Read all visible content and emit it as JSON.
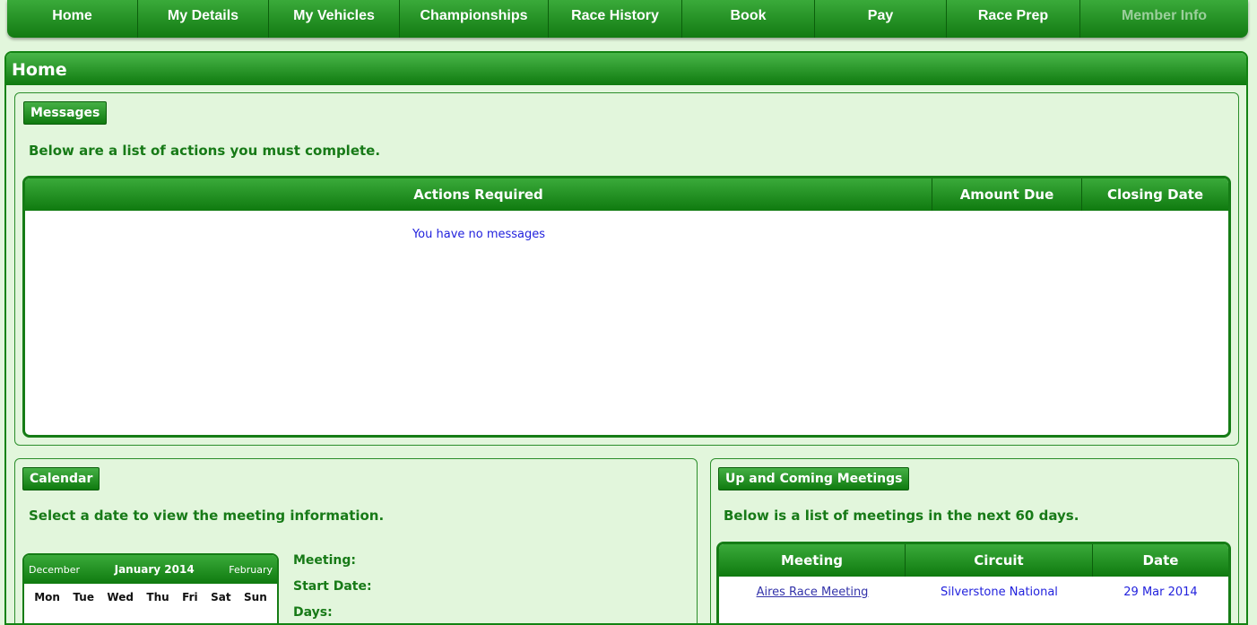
{
  "nav": {
    "items": [
      "Home",
      "My Details",
      "My Vehicles",
      "Championships",
      "Race History",
      "Book",
      "Pay",
      "Race Prep",
      "Member Info"
    ]
  },
  "page": {
    "title": "Home"
  },
  "messages": {
    "tag": "Messages",
    "description": "Below are a list of actions you must complete.",
    "columns": [
      "Actions Required",
      "Amount Due",
      "Closing Date"
    ],
    "empty_text": "You have no messages"
  },
  "calendar": {
    "tag": "Calendar",
    "description": "Select a date to view the meeting information.",
    "prev": "December",
    "month": "January 2014",
    "next": "February",
    "days": [
      "Mon",
      "Tue",
      "Wed",
      "Thu",
      "Fri",
      "Sat",
      "Sun"
    ],
    "labels": [
      "Meeting:",
      "Start Date:",
      "Days:"
    ]
  },
  "meetings": {
    "tag": "Up and Coming Meetings",
    "description": "Below is a list of meetings in the next 60 days.",
    "columns": [
      "Meeting",
      "Circuit",
      "Date"
    ],
    "rows": [
      {
        "meeting": "Aires Race Meeting",
        "circuit": "Silverstone National",
        "date": "29 Mar 2014"
      }
    ]
  },
  "colors": {
    "accent": "#138313",
    "page_bg": "#e2f6dc",
    "link": "#3333aa"
  }
}
